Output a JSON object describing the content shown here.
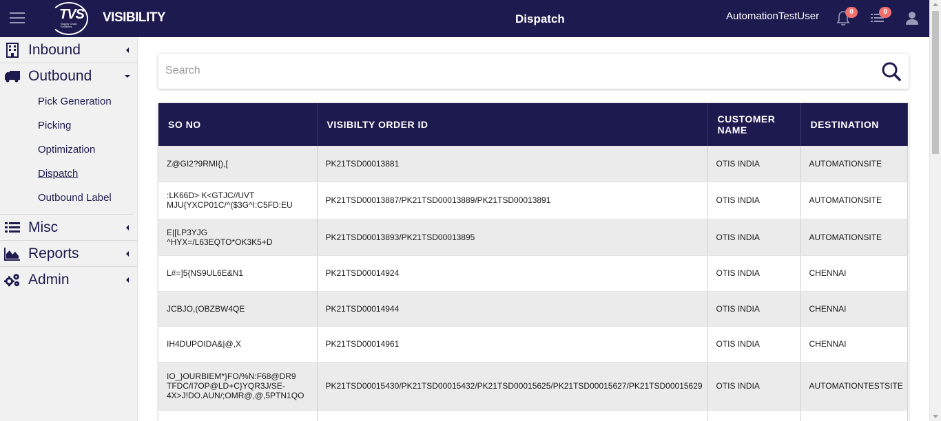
{
  "header": {
    "logo_text": "TVS",
    "logo_subtext": "Supply Chain Solutions",
    "brand": "VISIBILITY",
    "page_title": "Dispatch",
    "username": "AutomationTestUser",
    "notifications_count": "0",
    "tasks_count": "0",
    "icons": [
      "menu-icon",
      "bell-icon",
      "list-icon",
      "user-icon"
    ]
  },
  "sidebar": {
    "inbound": "Inbound",
    "outbound": "Outbound",
    "outbound_items": [
      "Pick Generation",
      "Picking",
      "Optimization",
      "Dispatch",
      "Outbound Label"
    ],
    "active_item": "Dispatch",
    "misc": "Misc",
    "reports": "Reports",
    "admin": "Admin"
  },
  "search": {
    "placeholder": "Search",
    "value": ""
  },
  "table": {
    "columns": [
      "SO NO",
      "VISIBILTY ORDER ID",
      "CUSTOMER NAME",
      "DESTINATION"
    ],
    "rows": [
      {
        "so_no": "Z@GI2?9RMI{),[",
        "order_id": "PK21TSD00013881",
        "customer": "OTIS INDIA",
        "destination": "AUTOMATIONSITE"
      },
      {
        "so_no": ":LK66D> K<GTJC//UVT MJU{YXCP01C/^($3G^I:C5FD:EU",
        "order_id": "PK21TSD00013887/PK21TSD00013889/PK21TSD00013891",
        "customer": "OTIS INDIA",
        "destination": "AUTOMATIONSITE"
      },
      {
        "so_no": "E|[LP3YJG ^HYX=/L63EQTO*OK3K5+D",
        "order_id": "PK21TSD00013893/PK21TSD00013895",
        "customer": "OTIS INDIA",
        "destination": "AUTOMATIONSITE"
      },
      {
        "so_no": "L#=]5{NS9UL6E&N1",
        "order_id": "PK21TSD00014924",
        "customer": "OTIS INDIA",
        "destination": "CHENNAI"
      },
      {
        "so_no": "JCBJO,(OBZBW4QE",
        "order_id": "PK21TSD00014944",
        "customer": "OTIS INDIA",
        "destination": "CHENNAI"
      },
      {
        "so_no": "IH4DUPOIDA&|@,X",
        "order_id": "PK21TSD00014961",
        "customer": "OTIS INDIA",
        "destination": "CHENNAI"
      },
      {
        "so_no": "IO_}OURBIEM*}FO/%N:F68@DR9 TFDC/I7OP@LD+C}YQR3J/SE-4X>J!DO.AUN/;OMR@,@,5PTN1QO",
        "order_id": "PK21TSD00015430/PK21TSD00015432/PK21TSD00015625/PK21TSD00015627/PK21TSD00015629",
        "customer": "OTIS INDIA",
        "destination": "AUTOMATIONTESTSITE"
      },
      {
        "so_no": "",
        "order_id": "",
        "customer": "",
        "destination": ""
      }
    ]
  },
  "colors": {
    "primary": "#1c1a4e",
    "badge": "#f07070",
    "row_alt": "#ebebeb"
  }
}
